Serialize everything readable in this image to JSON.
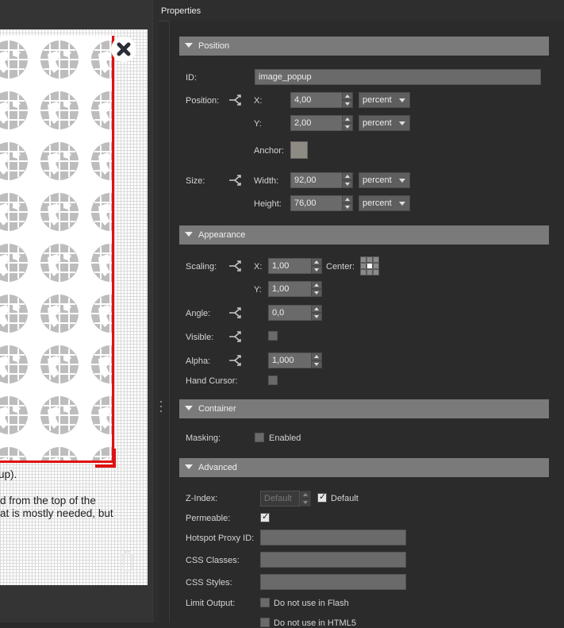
{
  "panel": {
    "title": "Properties"
  },
  "canvas": {
    "text_lines": [
      "up).",
      "d from the top of the",
      "at is mostly needed, but"
    ]
  },
  "sections": {
    "position": "Position",
    "appearance": "Appearance",
    "container": "Container",
    "advanced": "Advanced"
  },
  "position": {
    "id_label": "ID:",
    "id_value": "image_popup",
    "position_label": "Position:",
    "x_label": "X:",
    "x_value": "4,00",
    "x_unit": "percent",
    "y_label": "Y:",
    "y_value": "2,00",
    "y_unit": "percent",
    "anchor_label": "Anchor:",
    "anchor_color": "#8e8b84",
    "size_label": "Size:",
    "width_label": "Width:",
    "width_value": "92,00",
    "width_unit": "percent",
    "height_label": "Height:",
    "height_value": "76,00",
    "height_unit": "percent"
  },
  "appearance": {
    "scaling_label": "Scaling:",
    "x_label": "X:",
    "x_value": "1,00",
    "center_label": "Center:",
    "y_label": "Y:",
    "y_value": "1,00",
    "angle_label": "Angle:",
    "angle_value": "0,0",
    "visible_label": "Visible:",
    "visible_checked": false,
    "alpha_label": "Alpha:",
    "alpha_value": "1,000",
    "hand_cursor_label": "Hand Cursor:",
    "hand_cursor_checked": false
  },
  "container": {
    "masking_label": "Masking:",
    "enabled_label": "Enabled",
    "enabled_checked": false
  },
  "advanced": {
    "zindex_label": "Z-Index:",
    "zindex_placeholder": "Default",
    "default_label": "Default",
    "default_checked": true,
    "permeable_label": "Permeable:",
    "permeable_checked": true,
    "hotspot_label": "Hotspot Proxy ID:",
    "hotspot_value": "",
    "css_classes_label": "CSS Classes:",
    "css_classes_value": "",
    "css_styles_label": "CSS Styles:",
    "css_styles_value": "",
    "limit_output_label": "Limit Output:",
    "no_flash_label": "Do not use in Flash",
    "no_flash_checked": false,
    "no_html5_label": "Do not use in HTML5",
    "no_html5_checked": false
  },
  "colors": {
    "accent_red": "#e01010",
    "section_bg": "#7a7a7a",
    "panel_bg": "#2b2b2b"
  },
  "icons": {
    "close": "close-icon",
    "link": "link-icon",
    "globe": "globe-icon",
    "trash": "trash-icon"
  }
}
